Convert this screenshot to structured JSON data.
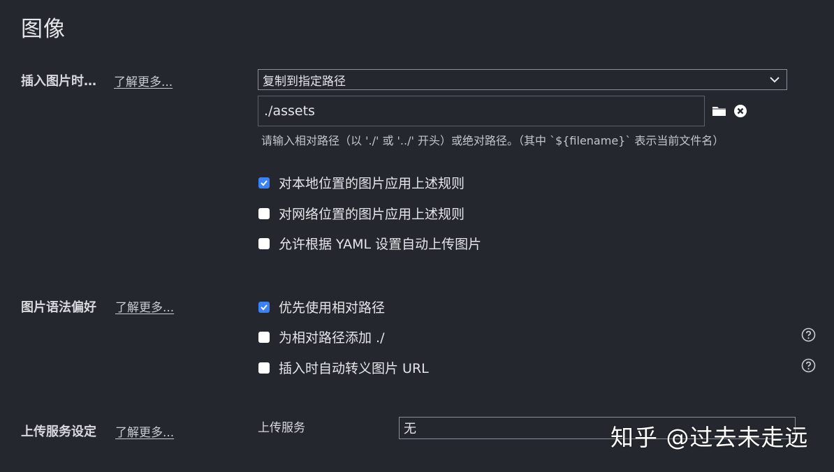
{
  "page": {
    "title": "图像"
  },
  "insert_image": {
    "label": "插入图片时…",
    "learn_more": "了解更多...",
    "action_selected": "复制到指定路径",
    "path_value": "./assets",
    "hint": "请输入相对路径（以 './' 或 '../' 开头）或绝对路径。（其中 `${filename}` 表示当前文件名）",
    "options": [
      {
        "label": "对本地位置的图片应用上述规则",
        "checked": true
      },
      {
        "label": "对网络位置的图片应用上述规则",
        "checked": false
      },
      {
        "label": "允许根据 YAML 设置自动上传图片",
        "checked": false
      }
    ]
  },
  "syntax_pref": {
    "label": "图片语法偏好",
    "learn_more": "了解更多...",
    "options": [
      {
        "label": "优先使用相对路径",
        "checked": true
      },
      {
        "label": "为相对路径添加 ./",
        "checked": false
      },
      {
        "label": "插入时自动转义图片 URL",
        "checked": false
      }
    ]
  },
  "upload": {
    "label": "上传服务设定",
    "learn_more": "了解更多...",
    "service_label": "上传服务",
    "service_value": "无"
  },
  "watermark": "知乎 @过去未走远",
  "icons": {
    "dropdown": "chevron-down-icon",
    "folder": "folder-icon",
    "clear": "close-circle-icon",
    "help": "question-circle-icon"
  },
  "colors": {
    "background": "#24272e",
    "checkbox_checked": "#3b82f6",
    "text": "#e4e6ea"
  }
}
